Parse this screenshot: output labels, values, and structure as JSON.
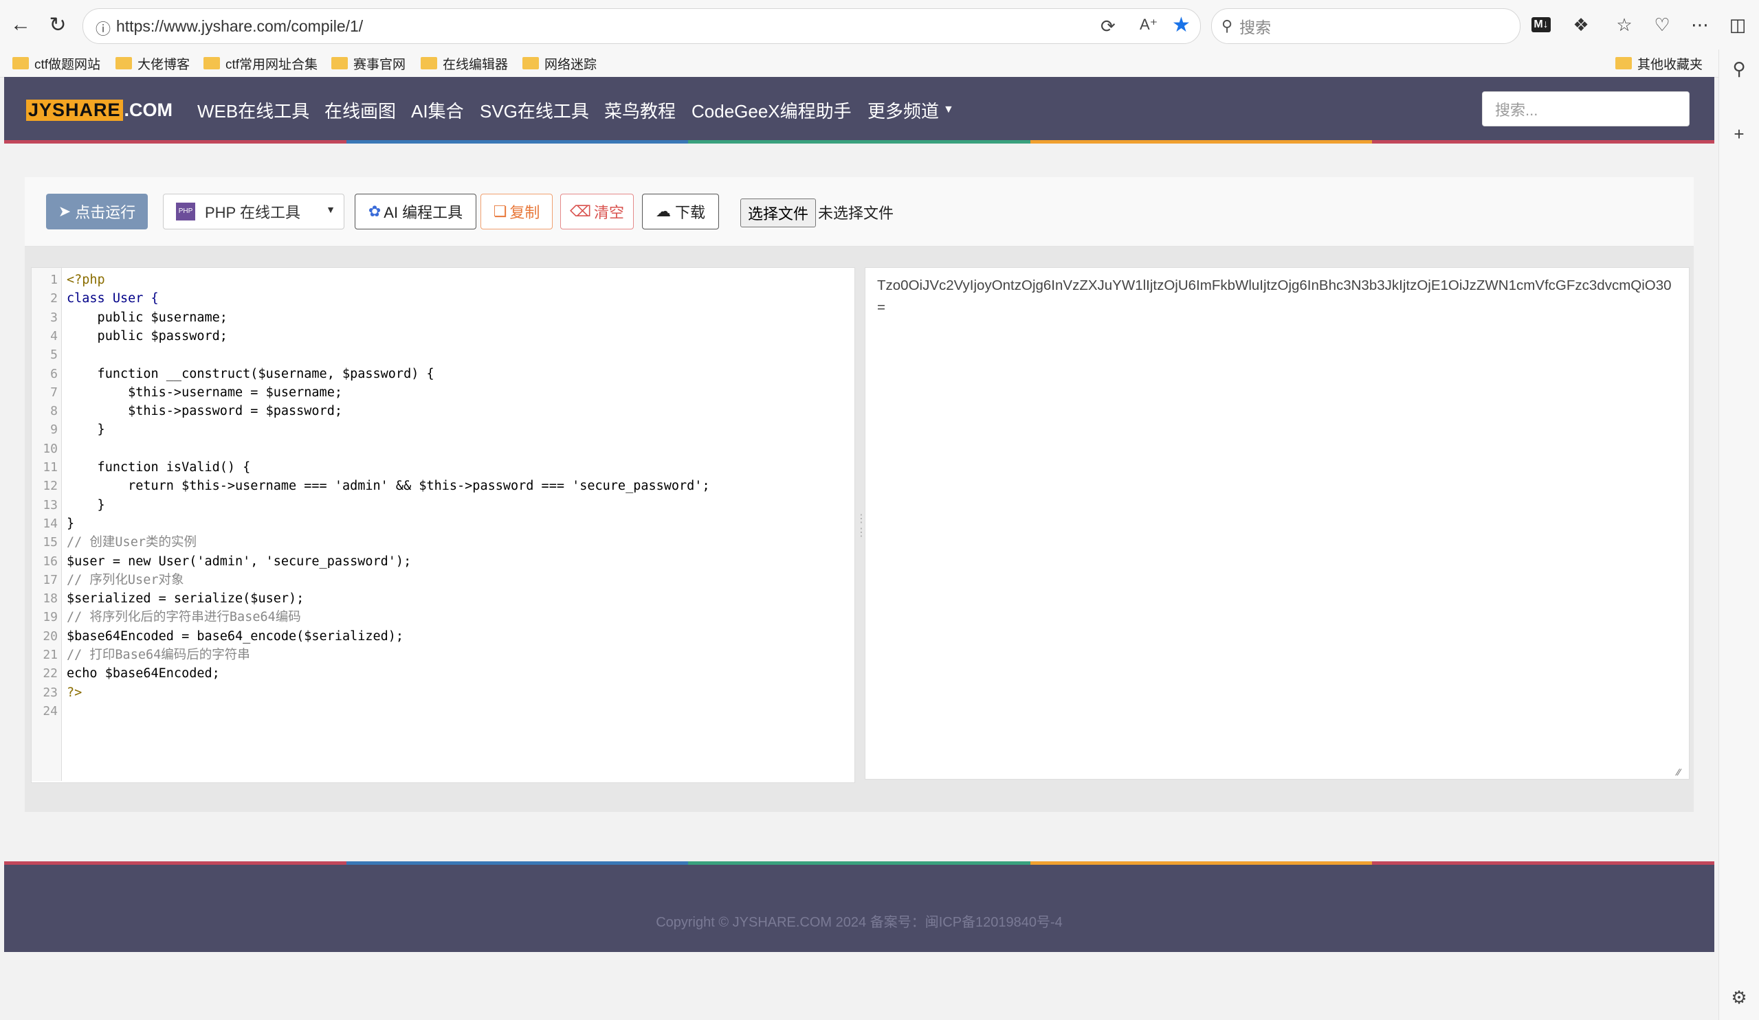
{
  "browser": {
    "url": "https://www.jyshare.com/compile/1/",
    "search_placeholder": "搜索",
    "bookmarks": [
      "ctf做题网站",
      "大佬博客",
      "ctf常用网址合集",
      "赛事官网",
      "在线编辑器",
      "网络迷踪"
    ],
    "other_bookmarks": "其他收藏夹"
  },
  "site": {
    "logo_left": "JYSHARE",
    "logo_right": ".COM",
    "menu": [
      "WEB在线工具",
      "在线画图",
      "AI集合",
      "SVG在线工具",
      "菜鸟教程",
      "CodeGeeX编程助手",
      "更多频道"
    ],
    "search_placeholder": "搜索..."
  },
  "toolbar": {
    "run": "点击运行",
    "language": "PHP 在线工具",
    "ai": "AI 编程工具",
    "copy": "复制",
    "clear": "清空",
    "download": "下载",
    "choose_file": "选择文件",
    "no_file": "未选择文件"
  },
  "editor": {
    "line_numbers": [
      "1",
      "2",
      "3",
      "4",
      "5",
      "6",
      "7",
      "8",
      "9",
      "10",
      "11",
      "12",
      "13",
      "14",
      "15",
      "16",
      "17",
      "18",
      "19",
      "20",
      "21",
      "22",
      "23",
      "24"
    ],
    "lines": [
      "<?php",
      "class User {",
      "    public $username;",
      "    public $password;",
      "",
      "    function __construct($username, $password) {",
      "        $this->username = $username;",
      "        $this->password = $password;",
      "    }",
      "",
      "    function isValid() {",
      "        return $this->username === 'admin' && $this->password === 'secure_password';",
      "    }",
      "}",
      "// 创建User类的实例",
      "$user = new User('admin', 'secure_password');",
      "// 序列化User对象",
      "$serialized = serialize($user);",
      "// 将序列化后的字符串进行Base64编码",
      "$base64Encoded = base64_encode($serialized);",
      "// 打印Base64编码后的字符串",
      "echo $base64Encoded;",
      "?>",
      ""
    ]
  },
  "output": {
    "text": "Tzo0OiJVc2VyIjoyOntzOjg6InVzZXJuYW1lIjtzOjU6ImFkbWluIjtzOjg6InBhc3N3b3JkIjtzOjE1OiJzZWN1cmVfcGFzc3dvcmQiO30="
  },
  "footer": {
    "copyright": "Copyright © JYSHARE.COM 2024 备案号：闽ICP备12019840号-4"
  },
  "colors": {
    "nav_bg": "#4c4c67",
    "logo_accent": "#f4a522",
    "run_button": "#7b95b6",
    "rainbow": [
      "#c2475b",
      "#3a78b6",
      "#3aa17e",
      "#f0a030",
      "#c2475b"
    ]
  }
}
